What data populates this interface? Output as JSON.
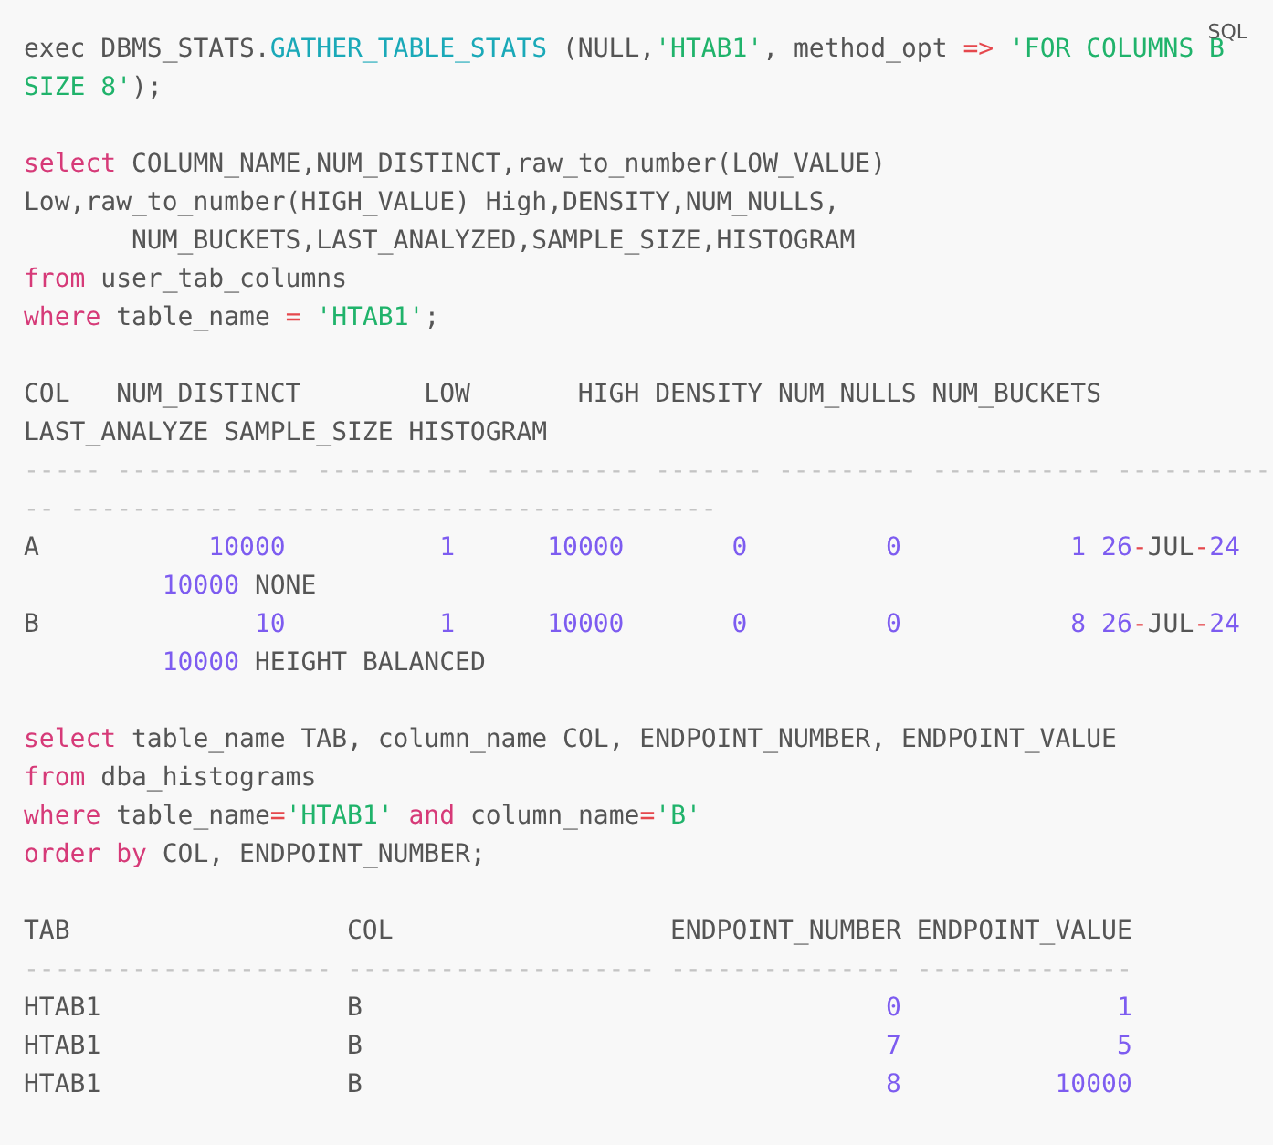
{
  "language_label": "SQL",
  "blocks": [
    {
      "lines": [
        [
          {
            "text": "exec DBMS_STATS.",
            "kind": "plain"
          },
          {
            "text": "GATHER_TABLE_STATS",
            "kind": "fn"
          },
          {
            "text": " (NULL,",
            "kind": "plain"
          },
          {
            "text": "'HTAB1'",
            "kind": "str"
          },
          {
            "text": ", method_opt ",
            "kind": "plain"
          },
          {
            "text": "=>",
            "kind": "op"
          },
          {
            "text": " 'FOR COLUMNS B",
            "kind": "str"
          }
        ],
        [
          {
            "text": "SIZE 8'",
            "kind": "str"
          },
          {
            "text": ");",
            "kind": "plain"
          }
        ]
      ]
    },
    {
      "lines": [
        [
          {
            "text": "select",
            "kind": "kw"
          },
          {
            "text": " COLUMN_NAME,NUM_DISTINCT,raw_to_number(LOW_VALUE)",
            "kind": "plain"
          }
        ],
        [
          {
            "text": "Low,raw_to_number(HIGH_VALUE) High,DENSITY,NUM_NULLS,",
            "kind": "plain"
          }
        ],
        [
          {
            "text": "       NUM_BUCKETS,LAST_ANALYZED,SAMPLE_SIZE,HISTOGRAM",
            "kind": "plain"
          }
        ],
        [
          {
            "text": "from",
            "kind": "kw"
          },
          {
            "text": " user_tab_columns",
            "kind": "plain"
          }
        ],
        [
          {
            "text": "where",
            "kind": "kw"
          },
          {
            "text": " table_name ",
            "kind": "plain"
          },
          {
            "text": "=",
            "kind": "op"
          },
          {
            "text": " 'HTAB1'",
            "kind": "str"
          },
          {
            "text": ";",
            "kind": "plain"
          }
        ]
      ]
    },
    {
      "lines": [
        [
          {
            "text": "COL   NUM_DISTINCT        LOW       HIGH DENSITY NUM_NULLS NUM_BUCKETS",
            "kind": "plain"
          }
        ],
        [
          {
            "text": "LAST_ANALYZE SAMPLE_SIZE HISTOGRAM",
            "kind": "plain"
          }
        ],
        [
          {
            "text": "----- ------------ ---------- ---------- ------- --------- ----------- ----------",
            "kind": "rule"
          }
        ],
        [
          {
            "text": "-- ----------- ------------------------------",
            "kind": "rule"
          }
        ],
        [
          {
            "text": "A",
            "kind": "plain"
          },
          {
            "text": "           10000",
            "kind": "num"
          },
          {
            "text": "          1",
            "kind": "num"
          },
          {
            "text": "      10000",
            "kind": "num"
          },
          {
            "text": "       0",
            "kind": "num"
          },
          {
            "text": "         0",
            "kind": "num"
          },
          {
            "text": "           1",
            "kind": "num"
          },
          {
            "text": " 26",
            "kind": "num"
          },
          {
            "text": "-",
            "kind": "op"
          },
          {
            "text": "JUL",
            "kind": "plain"
          },
          {
            "text": "-",
            "kind": "op"
          },
          {
            "text": "24",
            "kind": "num"
          }
        ],
        [
          {
            "text": "         10000",
            "kind": "num"
          },
          {
            "text": " NONE",
            "kind": "plain"
          }
        ],
        [
          {
            "text": "B",
            "kind": "plain"
          },
          {
            "text": "              10",
            "kind": "num"
          },
          {
            "text": "          1",
            "kind": "num"
          },
          {
            "text": "      10000",
            "kind": "num"
          },
          {
            "text": "       0",
            "kind": "num"
          },
          {
            "text": "         0",
            "kind": "num"
          },
          {
            "text": "           8",
            "kind": "num"
          },
          {
            "text": " 26",
            "kind": "num"
          },
          {
            "text": "-",
            "kind": "op"
          },
          {
            "text": "JUL",
            "kind": "plain"
          },
          {
            "text": "-",
            "kind": "op"
          },
          {
            "text": "24",
            "kind": "num"
          }
        ],
        [
          {
            "text": "         10000",
            "kind": "num"
          },
          {
            "text": " HEIGHT BALANCED",
            "kind": "plain"
          }
        ]
      ]
    },
    {
      "lines": [
        [
          {
            "text": "select",
            "kind": "kw"
          },
          {
            "text": " table_name TAB, column_name COL, ENDPOINT_NUMBER, ENDPOINT_VALUE",
            "kind": "plain"
          }
        ],
        [
          {
            "text": "from",
            "kind": "kw"
          },
          {
            "text": " dba_histograms",
            "kind": "plain"
          }
        ],
        [
          {
            "text": "where",
            "kind": "kw"
          },
          {
            "text": " table_name",
            "kind": "plain"
          },
          {
            "text": "=",
            "kind": "op"
          },
          {
            "text": "'HTAB1'",
            "kind": "str"
          },
          {
            "text": " and",
            "kind": "kw"
          },
          {
            "text": " column_name",
            "kind": "plain"
          },
          {
            "text": "=",
            "kind": "op"
          },
          {
            "text": "'B'",
            "kind": "str"
          }
        ],
        [
          {
            "text": "order by",
            "kind": "kw"
          },
          {
            "text": " COL, ENDPOINT_NUMBER;",
            "kind": "plain"
          }
        ]
      ]
    },
    {
      "lines": [
        [
          {
            "text": "TAB                  COL                  ENDPOINT_NUMBER ENDPOINT_VALUE",
            "kind": "plain"
          }
        ],
        [
          {
            "text": "-------------------- -------------------- --------------- --------------",
            "kind": "rule"
          }
        ],
        [
          {
            "text": "HTAB1                B",
            "kind": "plain"
          },
          {
            "text": "                                  0",
            "kind": "num"
          },
          {
            "text": "              1",
            "kind": "num"
          }
        ],
        [
          {
            "text": "HTAB1                B",
            "kind": "plain"
          },
          {
            "text": "                                  7",
            "kind": "num"
          },
          {
            "text": "              5",
            "kind": "num"
          }
        ],
        [
          {
            "text": "HTAB1                B",
            "kind": "plain"
          },
          {
            "text": "                                  8",
            "kind": "num"
          },
          {
            "text": "          10000",
            "kind": "num"
          }
        ]
      ]
    }
  ]
}
